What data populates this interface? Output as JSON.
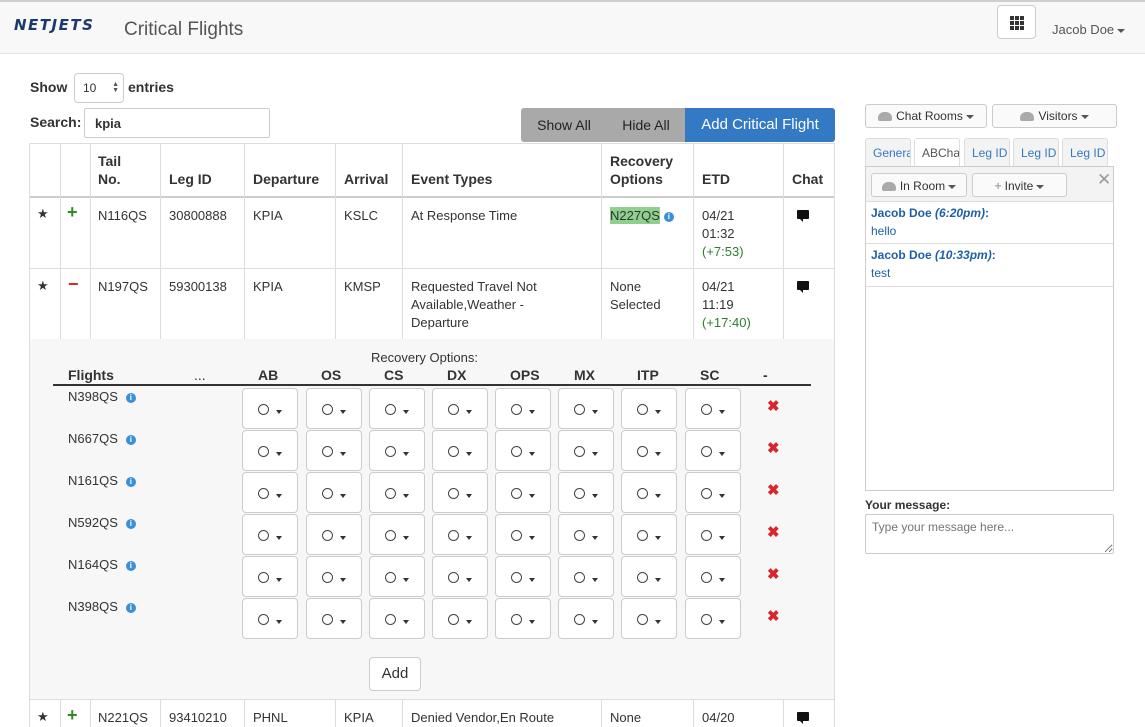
{
  "nav": {
    "brand": "NETJETS",
    "title": "Critical Flights",
    "user": "Jacob Doe"
  },
  "controls": {
    "show_label": "Show",
    "entries_value": "10",
    "entries_label": "entries",
    "search_label": "Search:",
    "search_value": "kpia",
    "show_all": "Show All",
    "hide_all": "Hide All",
    "add_critical": "Add Critical Flight"
  },
  "table": {
    "headers": {
      "tail1": "Tail",
      "tail2": "No.",
      "leg_id": "Leg ID",
      "departure": "Departure",
      "arrival": "Arrival",
      "event_types": "Event Types",
      "recovery1": "Recovery",
      "recovery2": "Options",
      "etd": "ETD",
      "chat": "Chat"
    },
    "rows": [
      {
        "star": "★",
        "toggle": "+",
        "tail": "N116QS",
        "leg_id": "30800888",
        "departure": "KPIA",
        "arrival": "KSLC",
        "event_1": "At Response Time",
        "event_2": "",
        "event_3": "",
        "recovery_1": "N227QS",
        "recovery_2": "",
        "etd_date": "04/21",
        "etd_time": "01:32",
        "etd_delta": "(+7:53)"
      },
      {
        "star": "★",
        "toggle": "−",
        "tail": "N197QS",
        "leg_id": "59300138",
        "departure": "KPIA",
        "arrival": "KMSP",
        "event_1": "Requested Travel Not",
        "event_2": "Available,Weather -",
        "event_3": "Departure",
        "recovery_1": "None",
        "recovery_2": "Selected",
        "etd_date": "04/21",
        "etd_time": "11:19",
        "etd_delta": "(+17:40)"
      },
      {
        "star": "★",
        "toggle": "+",
        "tail": "N221QS",
        "leg_id": "93410210",
        "departure": "PHNL",
        "arrival": "KPIA",
        "event_1": "Denied Vendor,En Route",
        "event_2": "",
        "event_3": "",
        "recovery_1": "None",
        "recovery_2": "",
        "etd_date": "04/20",
        "etd_time": "",
        "etd_delta": ""
      }
    ]
  },
  "recovery": {
    "title": "Recovery Options:",
    "columns": {
      "flights": "Flights",
      "dots": "...",
      "ab": "AB",
      "os": "OS",
      "cs": "CS",
      "dx": "DX",
      "ops": "OPS",
      "mx": "MX",
      "itp": "ITP",
      "sc": "SC",
      "minus": "-"
    },
    "flights": [
      "N398QS",
      "N667QS",
      "N161QS",
      "N592QS",
      "N164QS",
      "N398QS"
    ],
    "add_label": "Add"
  },
  "chat": {
    "chat_rooms": "Chat Rooms",
    "visitors": "Visitors",
    "tabs": [
      "General",
      "ABChat",
      "Leg ID",
      "Leg ID",
      "Leg ID"
    ],
    "in_room": "In Room",
    "invite": "Invite",
    "messages": [
      {
        "author": "Jacob Doe",
        "time": "(6:20pm)",
        "text": "hello"
      },
      {
        "author": "Jacob Doe",
        "time": "(10:33pm)",
        "text": "test"
      }
    ],
    "your_message_label": "Your message:",
    "placeholder": "Type your message here..."
  },
  "colors": {
    "primary": "#3379c4",
    "highlight": "#8fd08f",
    "add_green": "#2e8b20",
    "remove_red": "#d9262b"
  }
}
